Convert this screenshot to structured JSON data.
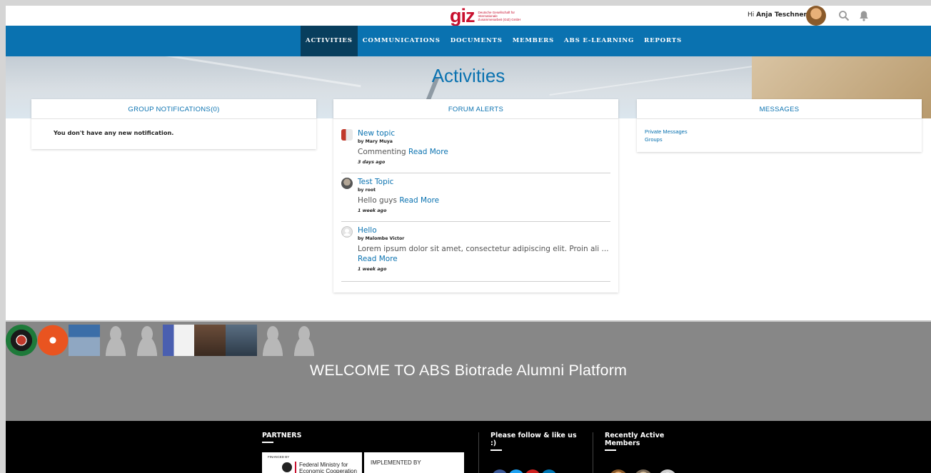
{
  "header": {
    "logo_mark": "giz",
    "logo_text": "Deutsche Gesellschaft für Internationale Zusammenarbeit (GIZ) GmbH",
    "greeting_prefix": "Hi",
    "user_name": "Anja Teschner",
    "icons": [
      "search-icon",
      "bell-icon"
    ]
  },
  "nav": {
    "items": [
      {
        "label": "ACTIVITIES"
      },
      {
        "label": "COMMUNICATIONS"
      },
      {
        "label": "DOCUMENTS"
      },
      {
        "label": "MEMBERS"
      },
      {
        "label": "ABS E-LEARNING"
      },
      {
        "label": "REPORTS"
      }
    ],
    "active": "ACTIVITIES"
  },
  "hero": {
    "title": "Activities"
  },
  "group_notifications": {
    "title": "GROUP NOTIFICATIONS(0)",
    "empty_text": "You don't have any new notification."
  },
  "forum_alerts": {
    "title": "FORUM ALERTS",
    "read_more": "Read More",
    "items": [
      {
        "title": "New topic",
        "by": "by Mary Muya",
        "text": "Commenting",
        "ago": "3 days ago"
      },
      {
        "title": "Test Topic",
        "by": "by root",
        "text": "Hello guys",
        "ago": "1 week ago"
      },
      {
        "title": "Hello",
        "by": "by Malombe Victor",
        "text": "Lorem ipsum dolor sit amet, consectetur adipiscing elit. Proin ali ...",
        "ago": "1 week ago"
      }
    ]
  },
  "messages": {
    "title": "MESSAGES",
    "links": [
      "Private Messages",
      "Groups"
    ]
  },
  "welcome": {
    "title": "WELCOME TO ABS Biotrade Alumni Platform"
  },
  "footer": {
    "partners_title": "PARTNERS",
    "financed_by": "FINANCED BY",
    "ministry": "Federal Ministry for Economic Cooperation",
    "implemented_by": "IMPLEMENTED BY",
    "follow_title": "Please follow & like us :)",
    "recent_title": "Recently Active Members",
    "social": [
      "facebook-icon",
      "twitter-icon",
      "youtube-icon",
      "linkedin-icon"
    ]
  },
  "colors": {
    "brand_blue": "#0a72b0",
    "nav_active": "#083e5d",
    "giz_red": "#c8102e",
    "welcome_band": "#878787",
    "footer_bg": "#000000"
  }
}
